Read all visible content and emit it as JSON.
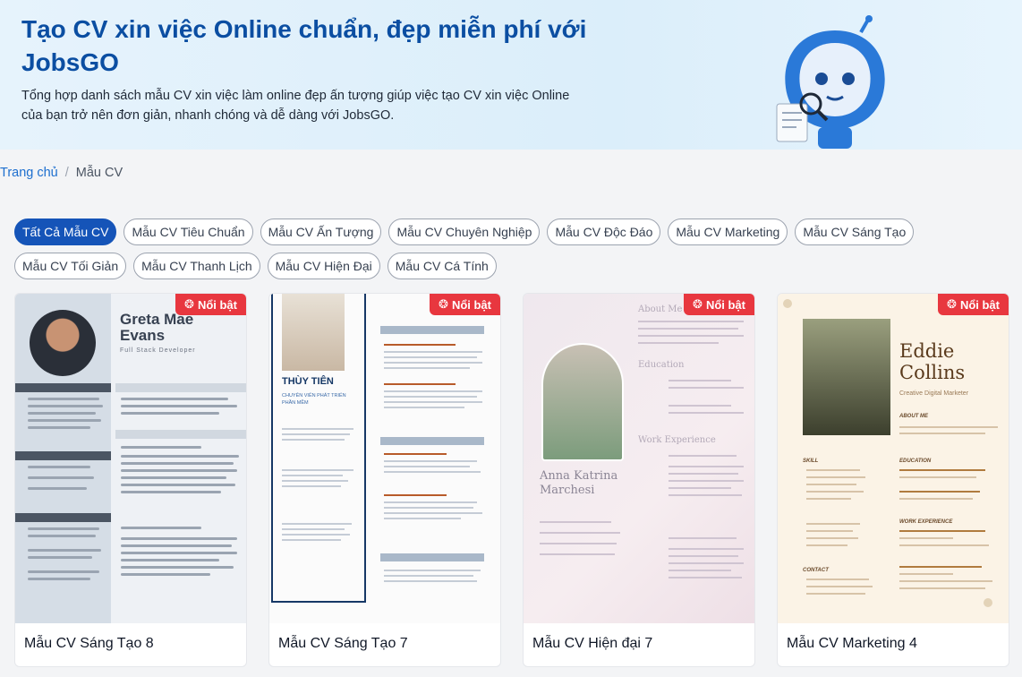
{
  "hero": {
    "title": "Tạo CV xin việc Online chuẩn, đẹp miễn phí với JobsGO",
    "description": "Tổng hợp danh sách mẫu CV xin việc làm online đẹp ấn tượng giúp việc tạo CV xin việc Online của bạn trở nên đơn giản, nhanh chóng và dễ dàng với JobsGO."
  },
  "breadcrumb": {
    "home": "Trang chủ",
    "separator": "/",
    "current": "Mẫu CV"
  },
  "filters": [
    {
      "label": "Tất Cả Mẫu CV",
      "active": true
    },
    {
      "label": "Mẫu CV Tiêu Chuẩn",
      "active": false
    },
    {
      "label": "Mẫu CV Ấn Tượng",
      "active": false
    },
    {
      "label": "Mẫu CV Chuyên Nghiệp",
      "active": false
    },
    {
      "label": "Mẫu CV Độc Đáo",
      "active": false
    },
    {
      "label": "Mẫu CV Marketing",
      "active": false
    },
    {
      "label": "Mẫu CV Sáng Tạo",
      "active": false
    },
    {
      "label": "Mẫu CV Tối Giản",
      "active": false
    },
    {
      "label": "Mẫu CV Thanh Lịch",
      "active": false
    },
    {
      "label": "Mẫu CV Hiện Đại",
      "active": false
    },
    {
      "label": "Mẫu CV Cá Tính",
      "active": false
    }
  ],
  "cards": [
    {
      "title": "Mẫu CV Sáng Tạo 8",
      "badge": "Nổi bật",
      "preview": {
        "name_line1": "Greta Mae",
        "name_line2": "Evans",
        "role": "Full Stack Developer"
      }
    },
    {
      "title": "Mẫu CV Sáng Tạo 7",
      "badge": "Nổi bật",
      "preview": {
        "name": "THÙY TIÊN",
        "role": "CHUYÊN VIÊN PHÁT TRIỂN PHẦN MỀM"
      }
    },
    {
      "title": "Mẫu CV Hiện đại 7",
      "badge": "Nổi bật",
      "preview": {
        "name_line1": "Anna Katrina",
        "name_line2": "Marchesi",
        "about": "About Me",
        "education": "Education",
        "work": "Work Experience"
      }
    },
    {
      "title": "Mẫu CV Marketing 4",
      "badge": "Nổi bật",
      "preview": {
        "name_line1": "Eddie",
        "name_line2": "Collins",
        "role": "Creative Digital Marketer",
        "about": "ABOUT ME",
        "skill": "SKILL",
        "education": "EDUCATION",
        "work": "WORK EXPERIENCE",
        "contact": "CONTACT"
      }
    }
  ],
  "colors": {
    "brand": "#0b4ea2",
    "chip_active": "#1554b8",
    "badge": "#e8373f"
  },
  "icons": {
    "badge_icon": "fire-icon",
    "mascot": "robot-mascot"
  }
}
